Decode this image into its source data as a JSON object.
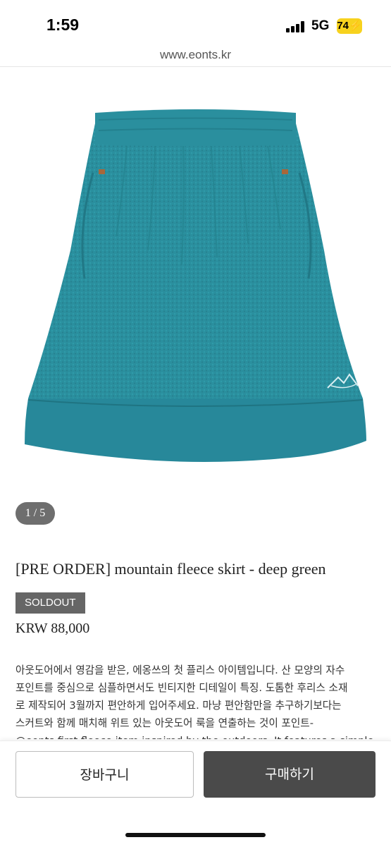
{
  "status": {
    "time": "1:59",
    "network": "5G",
    "battery": "74"
  },
  "browser": {
    "url": "www.eonts.kr"
  },
  "product": {
    "image_counter": "1 / 5",
    "title": "[PRE ORDER] mountain fleece skirt - deep green",
    "badge": "SOLDOUT",
    "price": "KRW 88,000",
    "color": "#2a8f9e",
    "description_lines": [
      "아웃도어에서 영감을 받은, 에옹쓰의 첫 플리스 아이템입니다. 산 모양의 자수",
      "포인트를 중심으로 심플하면서도 빈티지한 디테일이 특징. 도톰한 후리스 소재",
      "로 제작되어 3월까지 편안하게 입어주세요. 마냥 편안함만을 추구하기보다는",
      "스커트와 함께 매치해 위트 있는 아웃도어 룩을 연출하는 것이 포인트-",
      "@eonts first fleece item inspired by the outdoors. It features a simple"
    ]
  },
  "actions": {
    "cart_label": "장바구니",
    "buy_label": "구매하기"
  }
}
